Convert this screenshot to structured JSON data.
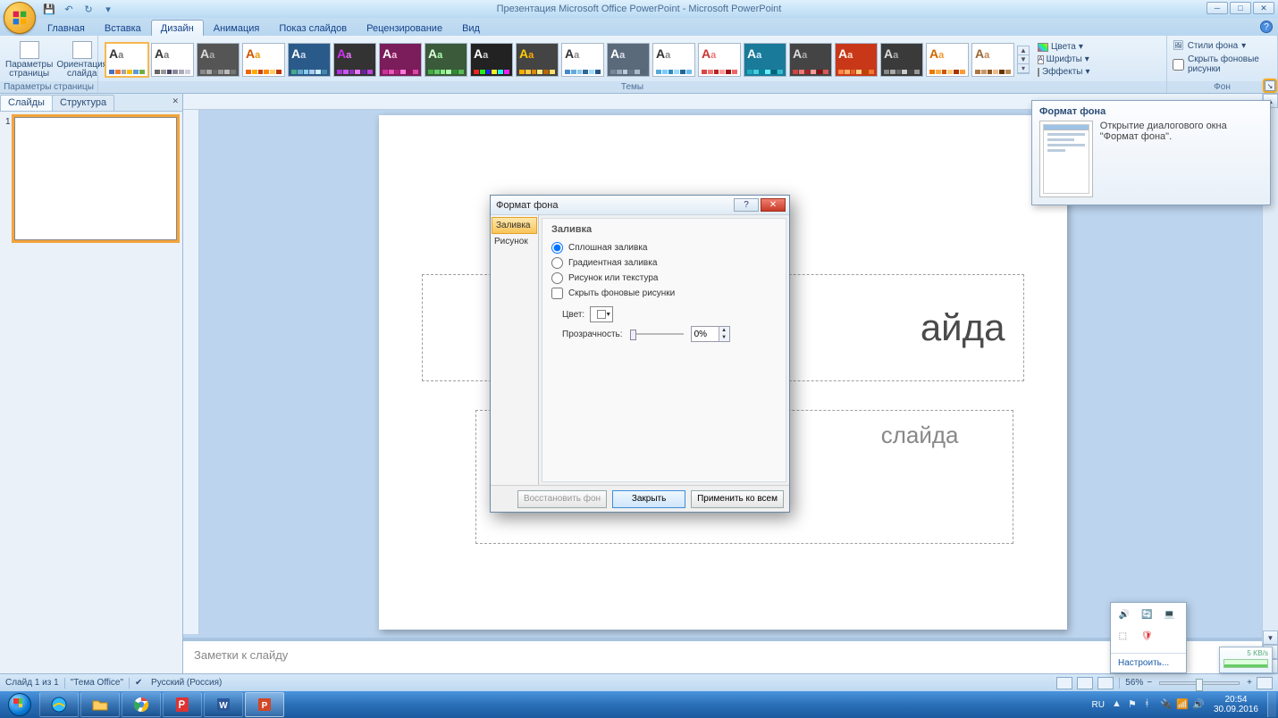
{
  "app_title": "Презентация Microsoft Office PowerPoint - Microsoft PowerPoint",
  "tabs": [
    "Главная",
    "Вставка",
    "Дизайн",
    "Анимация",
    "Показ слайдов",
    "Рецензирование",
    "Вид"
  ],
  "active_tab_index": 2,
  "ribbon": {
    "page_setup": {
      "group_label": "Параметры страницы",
      "params_btn": "Параметры страницы",
      "orient_btn": "Ориентация слайда"
    },
    "themes": {
      "group_label": "Темы",
      "colors_label": "Цвета",
      "fonts_label": "Шрифты",
      "effects_label": "Эффекты"
    },
    "background": {
      "group_label": "Фон",
      "styles_label": "Стили фона",
      "hide_label": "Скрыть фоновые рисунки"
    }
  },
  "left_panel": {
    "tab_slides": "Слайды",
    "tab_outline": "Структура",
    "slide_number": "1"
  },
  "slide": {
    "title_placeholder": "айда",
    "subtitle_placeholder": "слайда"
  },
  "notes_placeholder": "Заметки к слайду",
  "status": {
    "slide_count": "Слайд 1 из 1",
    "theme": "\"Тема Office\"",
    "language": "Русский (Россия)",
    "zoom": "56%"
  },
  "tooltip": {
    "title": "Формат фона",
    "text": "Открытие диалогового окна \"Формат фона\"."
  },
  "dialog": {
    "title": "Формат фона",
    "cat_fill": "Заливка",
    "cat_picture": "Рисунок",
    "heading": "Заливка",
    "opt_solid": "Сплошная заливка",
    "opt_gradient": "Градиентная заливка",
    "opt_picture": "Рисунок или текстура",
    "chk_hide": "Скрыть фоновые рисунки",
    "color_label": "Цвет:",
    "transparency_label": "Прозрачность:",
    "transparency_value": "0%",
    "btn_reset": "Восстановить фон",
    "btn_close": "Закрыть",
    "btn_applyall": "Применить ко всем"
  },
  "tray": {
    "customize": "Настроить...",
    "net_speed": "5 KB/s",
    "lang": "RU",
    "time": "20:54",
    "date": "30.09.2016"
  }
}
